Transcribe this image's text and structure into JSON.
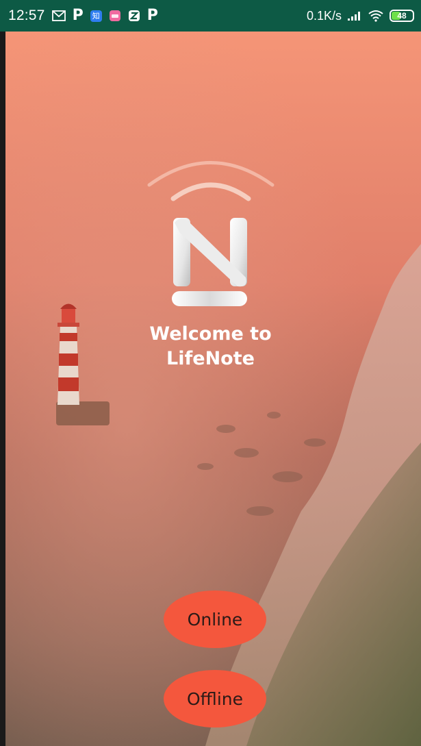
{
  "status_bar": {
    "time": "12:57",
    "network_speed": "0.1K/s",
    "battery_level": "48",
    "battery_fraction": 0.48,
    "icons": [
      "mail-icon",
      "p-app-icon",
      "zhihu-app-icon",
      "pink-app-icon",
      "z-app-icon",
      "p-app-icon",
      "signal-icon",
      "wifi-icon",
      "battery-icon"
    ],
    "p_glyph": "P",
    "zhihu_glyph": "知"
  },
  "welcome": {
    "line1": "Welcome to",
    "line2": "LifeNote"
  },
  "buttons": {
    "online_label": "Online",
    "offline_label": "Offline"
  },
  "colors": {
    "status_bar": "#0d5a45",
    "button": "#f4573d",
    "battery_fill": "#6ee04a"
  }
}
